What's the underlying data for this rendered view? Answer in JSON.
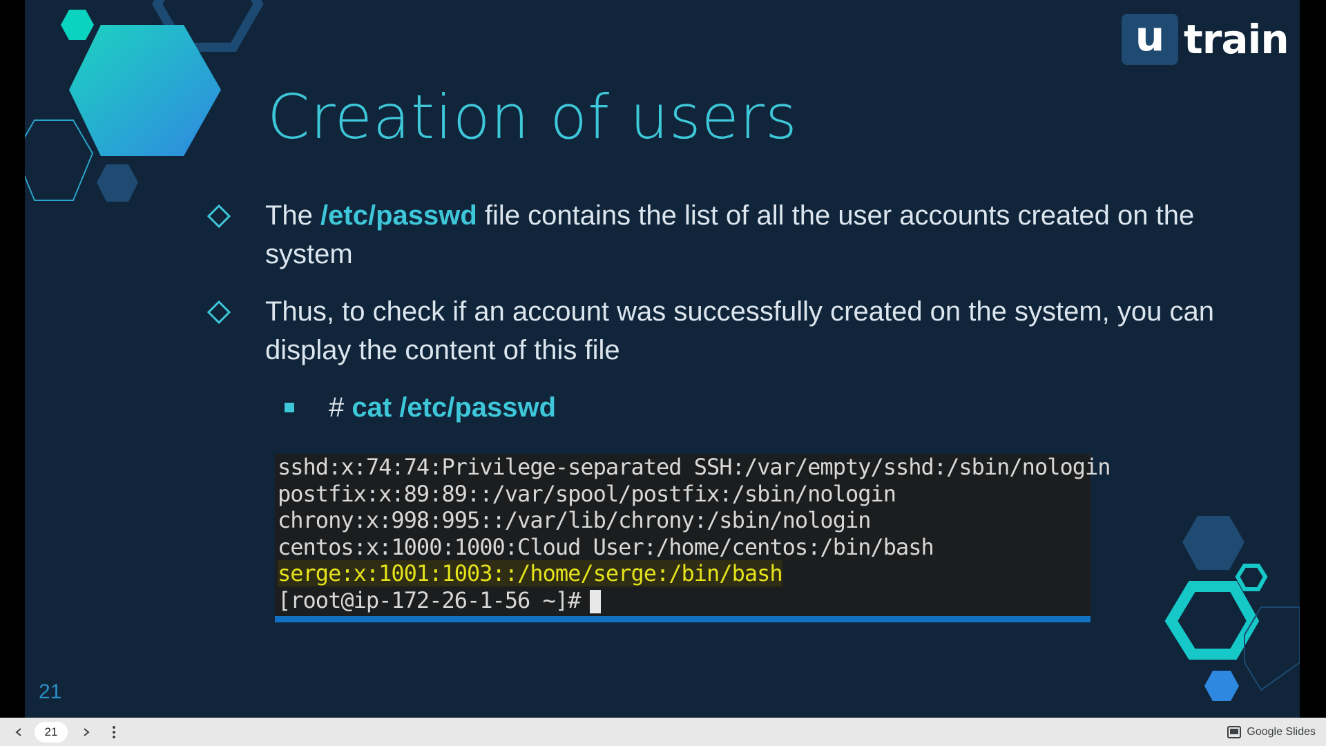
{
  "slide": {
    "title": "Creation of users",
    "logo": {
      "u": "u",
      "train": "train"
    },
    "bullets": [
      {
        "before": "The ",
        "highlight": "/etc/passwd",
        "after": " file contains the list of all the user accounts created on the system"
      },
      {
        "text": "Thus, to check if an account was successfully created on the system, you can display the content of this file"
      }
    ],
    "sub_bullet": {
      "prefix": "# ",
      "command": "cat /etc/passwd"
    },
    "terminal": {
      "lines": [
        "sshd:x:74:74:Privilege-separated SSH:/var/empty/sshd:/sbin/nologin",
        "postfix:x:89:89::/var/spool/postfix:/sbin/nologin",
        "chrony:x:998:995::/var/lib/chrony:/sbin/nologin",
        "centos:x:1000:1000:Cloud User:/home/centos:/bin/bash"
      ],
      "highlighted_line": "serge:x:1001:1003::/home/serge:/bin/bash",
      "prompt": "[root@ip-172-26-1-56 ~]#"
    },
    "page_number": "21"
  },
  "viewer": {
    "current_page": "21",
    "brand": "Google Slides"
  },
  "colors": {
    "slide_bg": "#10253a",
    "accent": "#3ec6d9",
    "terminal_bg": "#1c1d1e",
    "terminal_highlight": "#e4e21b",
    "terminal_border": "#1371c4"
  }
}
